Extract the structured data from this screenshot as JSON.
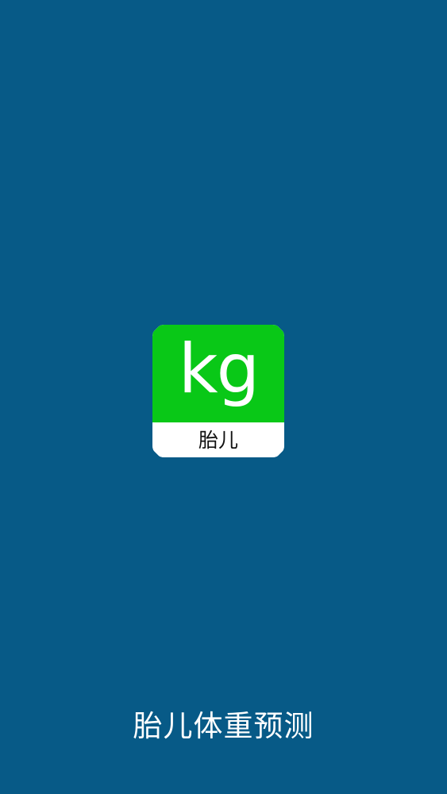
{
  "splash": {
    "icon_text": "kg",
    "icon_subtitle": "胎儿",
    "app_title": "胎儿体重预测"
  },
  "colors": {
    "background": "#075a87",
    "icon_accent": "#09c817",
    "icon_label_background": "#ffffff",
    "title_text": "#ffffff"
  }
}
